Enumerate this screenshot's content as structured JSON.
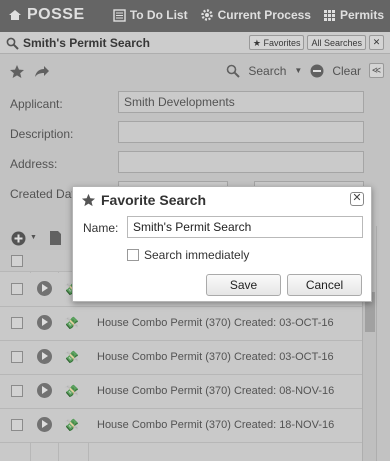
{
  "app": {
    "brand": "POSSE"
  },
  "topnav": {
    "todo": "To Do List",
    "process": "Current Process",
    "permits": "Permits"
  },
  "page": {
    "title": "Smith's Permit Search",
    "favorites": "Favorites",
    "all_searches": "All Searches"
  },
  "toolbar": {
    "search": "Search",
    "clear": "Clear"
  },
  "form": {
    "applicant_label": "Applicant:",
    "applicant_value": "Smith Developments",
    "description_label": "Description:",
    "address_label": "Address:",
    "created_label": "Created Dat"
  },
  "rows": [
    {
      "text": ""
    },
    {
      "text": ""
    },
    {
      "text": "House Combo Permit (370) Created: 03-OCT-16"
    },
    {
      "text": "House Combo Permit (370) Created: 03-OCT-16"
    },
    {
      "text": "House Combo Permit (370) Created: 08-NOV-16"
    },
    {
      "text": "House Combo Permit (370) Created: 18-NOV-16"
    }
  ],
  "dialog": {
    "title": "Favorite Search",
    "name_label": "Name:",
    "name_value": "Smith's Permit Search",
    "checkbox_label": "Search immediately",
    "save": "Save",
    "cancel": "Cancel"
  }
}
